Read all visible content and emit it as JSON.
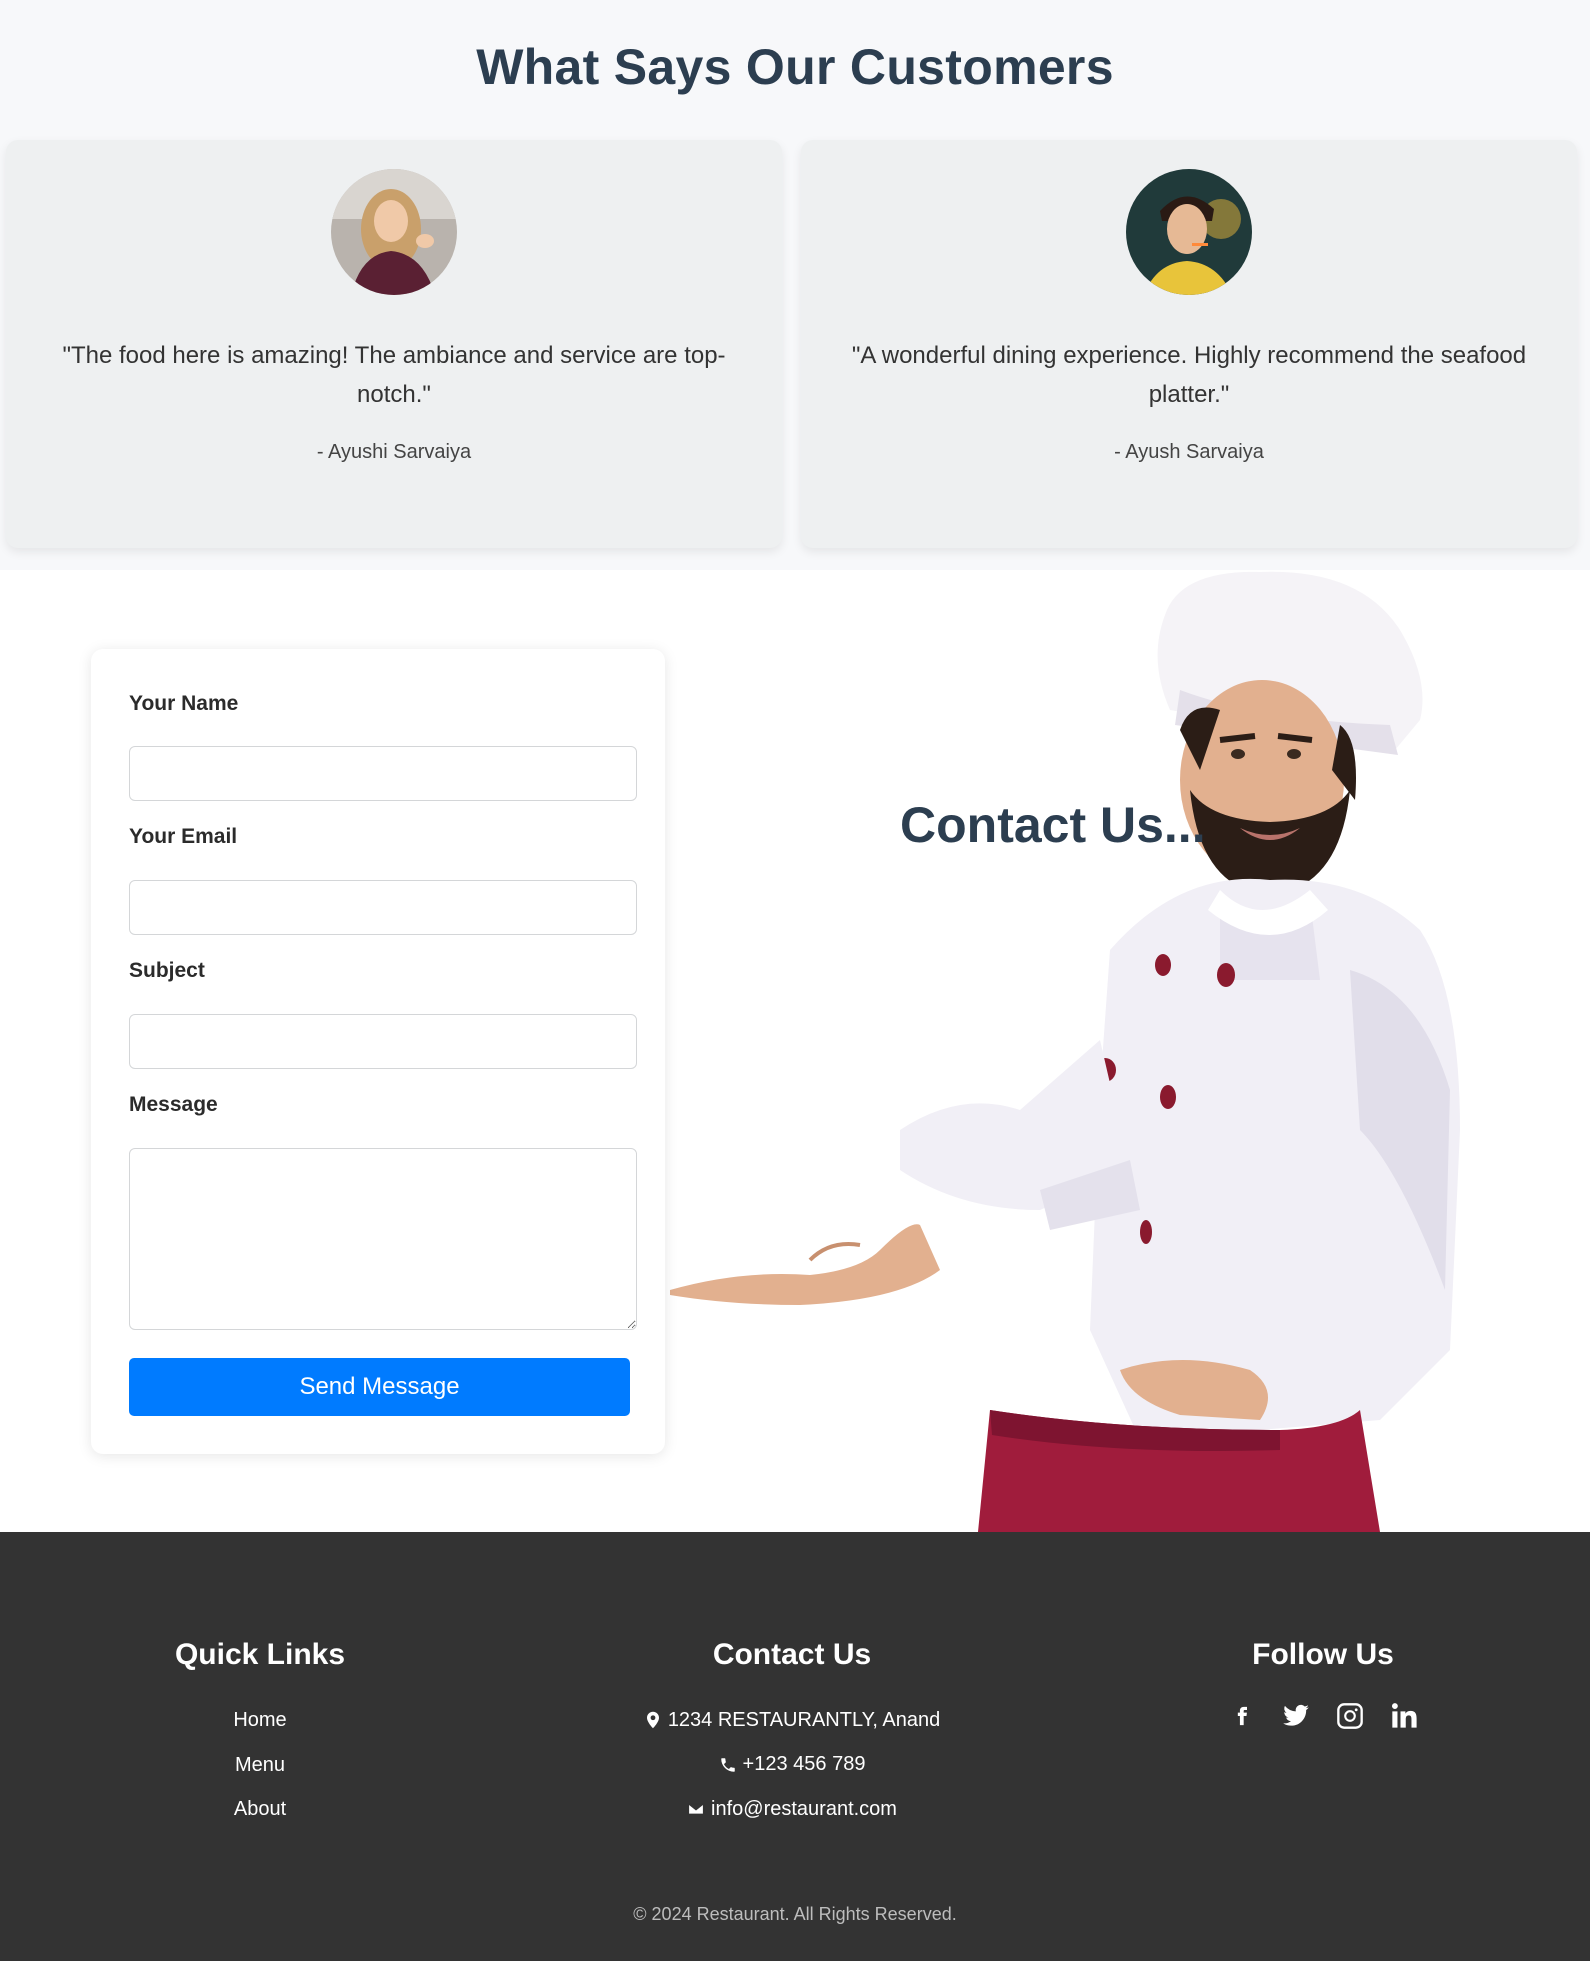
{
  "testimonials": {
    "title": "What Says Our Customers",
    "items": [
      {
        "quote": "\"The food here is amazing! The ambiance and service are top-notch.\"",
        "author": "- Ayushi Sarvaiya"
      },
      {
        "quote": "\"A wonderful dining experience. Highly recommend the seafood platter.\"",
        "author": "- Ayush Sarvaiya"
      }
    ]
  },
  "contact_form": {
    "name_label": "Your Name",
    "email_label": "Your Email",
    "subject_label": "Subject",
    "message_label": "Message",
    "name_value": "",
    "email_value": "",
    "subject_value": "",
    "message_value": "",
    "send_label": "Send Message"
  },
  "contact_title": "Contact Us...",
  "footer": {
    "quick_links_title": "Quick Links",
    "quick_links": [
      "Home",
      "Menu",
      "About"
    ],
    "contact_title": "Contact Us",
    "address": "1234 RESTAURANTLY, Anand",
    "phone": "+123 456 789",
    "email": "info@restaurant.com",
    "follow_title": "Follow Us",
    "socials": [
      "facebook-icon",
      "twitter-icon",
      "instagram-icon",
      "linkedin-icon"
    ],
    "copyright": "© 2024 Restaurant. All Rights Reserved."
  },
  "colors": {
    "heading": "#2c3e50",
    "button": "#007bff",
    "footer_bg": "#333333",
    "apron": "#a01c3c"
  }
}
